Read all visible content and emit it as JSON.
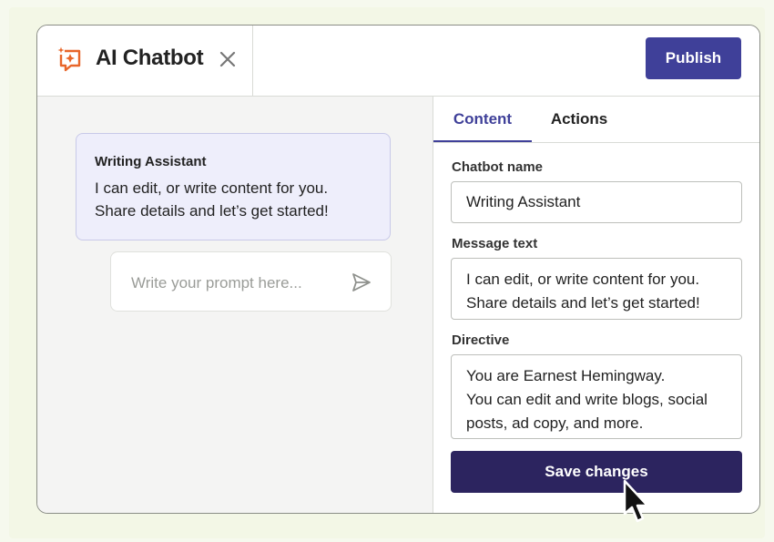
{
  "header": {
    "title": "AI Chatbot",
    "brand_icon": "chatbot-sparkle-icon",
    "close_icon": "close-icon",
    "publish_label": "Publish",
    "brand_color": "#e8662a",
    "accent_color": "#3f4099"
  },
  "preview": {
    "bot_name": "Writing Assistant",
    "message_text": "I can edit, or write content for you.\nShare details and let’s get started!",
    "prompt_placeholder": "Write your prompt here...",
    "send_icon": "send-icon"
  },
  "tabs": [
    {
      "label": "Content",
      "active": true
    },
    {
      "label": "Actions",
      "active": false
    }
  ],
  "form": {
    "name_label": "Chatbot name",
    "name_value": "Writing Assistant",
    "message_label": "Message text",
    "message_value": "I can edit, or write content for you.\nShare details and let’s get started!",
    "directive_label": "Directive",
    "directive_value": "You are Earnest Hemingway.\nYou can edit and write blogs, social posts, ad copy, and more.",
    "save_label": "Save changes",
    "save_color": "#2c245f"
  },
  "cursor_icon": "mouse-pointer-icon"
}
